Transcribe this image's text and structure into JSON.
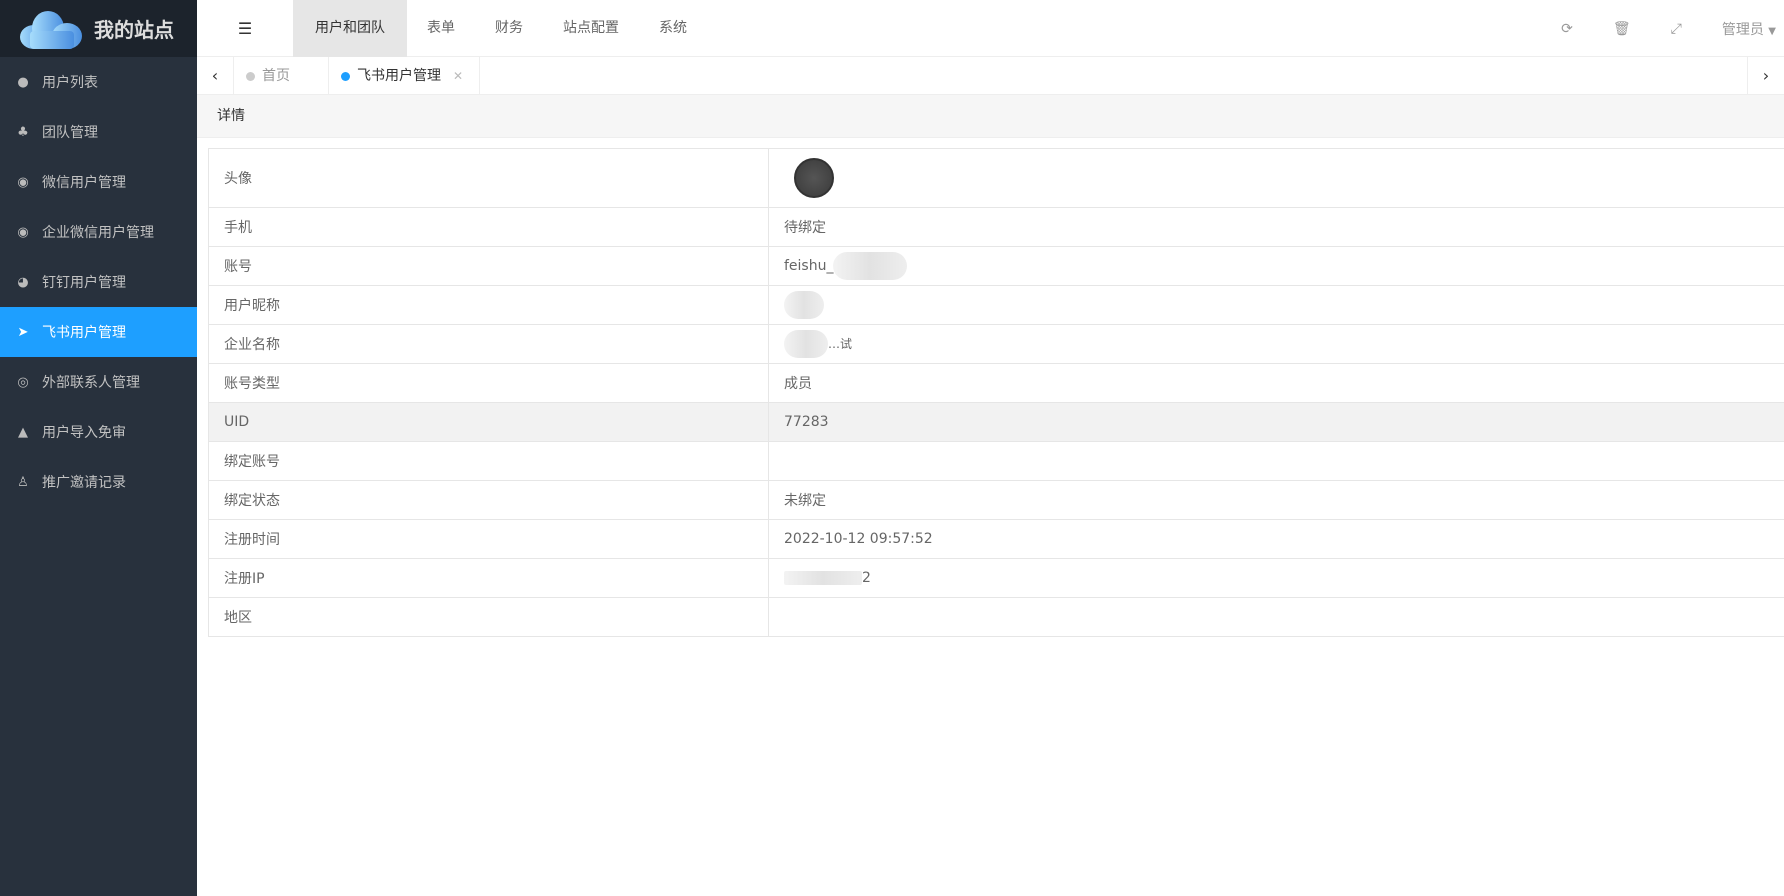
{
  "brand": {
    "title": "我的站点"
  },
  "sidebar": {
    "items": [
      {
        "label": "用户列表",
        "icon": "user-icon"
      },
      {
        "label": "团队管理",
        "icon": "users-icon"
      },
      {
        "label": "微信用户管理",
        "icon": "wechat-icon"
      },
      {
        "label": "企业微信用户管理",
        "icon": "wechat-icon"
      },
      {
        "label": "钉钉用户管理",
        "icon": "dingtalk-icon"
      },
      {
        "label": "飞书用户管理",
        "icon": "paper-plane-icon",
        "active": true
      },
      {
        "label": "外部联系人管理",
        "icon": "user-circle-icon"
      },
      {
        "label": "用户导入免审",
        "icon": "user-secret-icon"
      },
      {
        "label": "推广邀请记录",
        "icon": "user-outline-icon"
      }
    ]
  },
  "topnav": {
    "items": [
      "用户和团队",
      "表单",
      "财务",
      "站点配置",
      "系统"
    ],
    "active": "用户和团队",
    "user": "管理员"
  },
  "tabs": [
    {
      "label": "首页"
    },
    {
      "label": "飞书用户管理",
      "active": true
    }
  ],
  "card": {
    "title": "详情"
  },
  "details": [
    {
      "label": "头像",
      "value": ""
    },
    {
      "label": "手机",
      "value": "待绑定"
    },
    {
      "label": "账号",
      "value": "feishu_"
    },
    {
      "label": "用户昵称",
      "value": ""
    },
    {
      "label": "企业名称",
      "value": "…试"
    },
    {
      "label": "账号类型",
      "value": "成员"
    },
    {
      "label": "UID",
      "value": "77283"
    },
    {
      "label": "绑定账号",
      "value": ""
    },
    {
      "label": "绑定状态",
      "value": "未绑定"
    },
    {
      "label": "注册时间",
      "value": "2022-10-12 09:57:52"
    },
    {
      "label": "注册IP",
      "value": "2"
    },
    {
      "label": "地区",
      "value": ""
    }
  ],
  "colors": {
    "sidebar": "#28313d",
    "active": "#1e9fff"
  }
}
